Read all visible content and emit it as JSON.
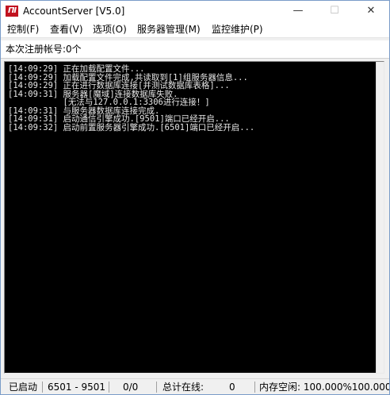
{
  "window": {
    "title": "AccountServer [V5.0]",
    "icon_text": "ΠΙ",
    "controls": {
      "minimize": "—",
      "maximize": "☐",
      "close": "✕"
    }
  },
  "menu": [
    {
      "label": "控制(F)"
    },
    {
      "label": "查看(V)"
    },
    {
      "label": "选项(O)"
    },
    {
      "label": "服务器管理(M)"
    },
    {
      "label": "监控维护(P)"
    }
  ],
  "info": {
    "text": "本次注册帐号:0个"
  },
  "log": [
    {
      "ts": "[14:09:29]",
      "msg": " 正在加载配置文件..."
    },
    {
      "ts": "[14:09:29]",
      "msg": " 加载配置文件完成,共读取到[1]组服务器信息..."
    },
    {
      "ts": "[14:09:29]",
      "msg": " 正在进行数据库连接[并测试数据库表格]..."
    },
    {
      "ts": "[14:09:31]",
      "msg": " 服务器[魔域]连接数据库失败."
    },
    {
      "ts": "",
      "msg": "           [无法与127.0.0.1:3306进行连接！]"
    },
    {
      "ts": "[14:09:31]",
      "msg": " 与服务器数据库连接完成."
    },
    {
      "ts": "[14:09:31]",
      "msg": " 启动通信引擎成功.[9501]端口已经开启..."
    },
    {
      "ts": "[14:09:32]",
      "msg": " 启动前置服务器引擎成功.[6501]端口已经开启..."
    }
  ],
  "status": {
    "state": "已启动",
    "ports": "6501 - 9501",
    "ratio": "0/0",
    "online_label": "总计在线:",
    "online_value": "0",
    "memory": "内存空闲: 100.000%100.000%"
  }
}
